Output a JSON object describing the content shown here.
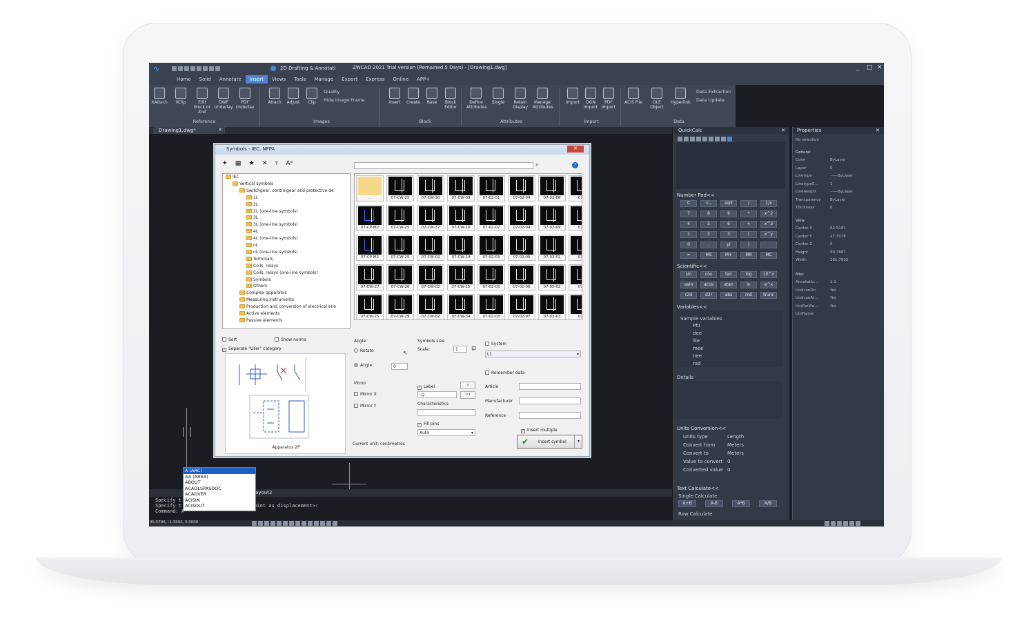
{
  "window": {
    "title": "ZWCAD 2021 Trial version (Remained 5 Days) - [Drawing1.dwg]",
    "workspace": "2D Drafting & Annotati"
  },
  "tabs": [
    "Home",
    "Solid",
    "Annotate",
    "Insert",
    "Views",
    "Tools",
    "Manage",
    "Export",
    "Express",
    "Online",
    "APP+"
  ],
  "ribbon": {
    "reference": [
      "XAttach",
      "XClip",
      "Edit block or Xref",
      "DWF Underlay",
      "PDF Underlay"
    ],
    "images": [
      "Attach",
      "Adjust",
      "Clip"
    ],
    "image_opts": [
      "Quality",
      "Hide Image Frame"
    ],
    "block": [
      "Insert",
      "Create",
      "Base",
      "Block Editor"
    ],
    "attributes": [
      "Define Attributes",
      "Single",
      "Retain Display",
      "Manage Attributes"
    ],
    "import": [
      "Import",
      "DGN Import",
      "PDF Import"
    ],
    "data": [
      "ACIS File",
      "OLE Object",
      "Hyperlink"
    ],
    "data_opts": [
      "Data Extraction",
      "Data Update"
    ],
    "groups": [
      "Reference",
      "Images",
      "Block",
      "Attributes",
      "Import",
      "Data"
    ]
  },
  "doc_tab": "Drawing1.dwg*",
  "dialog": {
    "title": "Symbols - IEC, NFPA",
    "tree": [
      "IEC",
      "Vertical symbols",
      "Switchgear, controlgear and protective de",
      "1L",
      "2L",
      "2L (one-line symbols)",
      "3L",
      "3L (one-line symbols)",
      "4L",
      "4L (one-line symbols)",
      "nL",
      "nL (one-line symbols)",
      "Terminals",
      "Coils, relays",
      "Coils, relays (one-line symbols)",
      "Symbols",
      "Others",
      "Complex apparatus",
      "Measuring instruments",
      "Production and conversion of electrical ene",
      "Active elements",
      "Passive elements"
    ],
    "symbols": [
      "..",
      "07-CW-25",
      "07-CW-30",
      "07-CW-03",
      "07-02-01",
      "07-02-04",
      "07-02-08",
      "07-0",
      "07-CP-M2",
      "07-CW-25",
      "07-CW-37",
      "07-CW-10",
      "07-02-02",
      "07-02-04",
      "07-02-09",
      "07-0",
      "07-CP-M2",
      "07-CW-25",
      "07-CW-02",
      "07-CW-14",
      "07-02-03",
      "07-02-05",
      "07-03-01",
      "07-0",
      "07-CW-27",
      "07-CW-26",
      "07-CW-02",
      "07-CW-15",
      "07-02-03",
      "07-02-06",
      "07-03-02",
      "07-0",
      "07-CW-25",
      "07-CW-29",
      "07-CW-02",
      "07-CW-34",
      "07-02-03",
      "07-02-07",
      "07-03-03",
      "07-0"
    ],
    "sort": "Sort",
    "show_norms": "Show norms",
    "separate_user": "Separate \"User\" category",
    "preview_caption": "Apparatus 2P",
    "angle": "Angle",
    "rotate": "Rotate",
    "angle_label": "Angle:",
    "angle_value": "0",
    "mirror": "Mirror",
    "mirror_x": "Mirror X",
    "mirror_y": "Mirror Y",
    "symbols_size": "Symbols size",
    "scale_label": "Scale:",
    "scale_value": "1",
    "label": "Label",
    "label_value": "-Q",
    "characteristics": "Characteristics",
    "fill_pins": "Fill pins",
    "fill_value": "Auto",
    "system": "System",
    "system_value": "L1",
    "remember": "Remember data",
    "article": "Article",
    "manufacturer": "Manufacturer",
    "reference": "Reference",
    "insert_multiple": "Insert multiple",
    "insert_symbol": "Insert symbol",
    "current_unit": "Current unit: centimetres"
  },
  "quickcalc": {
    "title": "QuickCalc",
    "numpad_title": "Number Pad<<",
    "numpad": [
      "C",
      "<--",
      "sqrt",
      "/",
      "1/x",
      "7",
      "8",
      "9",
      "*",
      "x^2",
      "4",
      "5",
      "6",
      "+",
      "x^3",
      "1",
      "2",
      "3",
      "(",
      "x^y",
      "0",
      ".",
      "pi",
      ")",
      "",
      "=",
      "MS",
      "M+",
      "MR",
      "MC"
    ],
    "sci_title": "Scientific<<",
    "sci": [
      "sin",
      "cos",
      "tan",
      "log",
      "10^x",
      "asin",
      "acos",
      "atan",
      "ln",
      "e^x",
      "r2d",
      "d2r",
      "abs",
      "rnd",
      "trunc"
    ],
    "vars_title": "Variables<<",
    "vars_group": "Sample variables",
    "vars": [
      "Phi",
      "dee",
      "ille",
      "mee",
      "nee",
      "rad"
    ],
    "details": "Details",
    "units_title": "Units Conversion<<",
    "units": [
      [
        "Units type",
        "Length"
      ],
      [
        "Convert from",
        "Meters"
      ],
      [
        "Convert to",
        "Meters"
      ],
      [
        "Value to convert",
        "0"
      ],
      [
        "Converted value",
        "0"
      ]
    ],
    "text_calc": "Text Calculate<<",
    "single_calc": "Single Calculate",
    "text_ops": [
      "A+B",
      "A-B",
      "A*B",
      "A/B"
    ],
    "row_calc": "Row Calculate"
  },
  "properties": {
    "title": "Properties",
    "selection": "No selection",
    "general": "General",
    "general_rows": [
      [
        "Color",
        "ByLayer"
      ],
      [
        "Layer",
        "0"
      ],
      [
        "Linetype",
        "——ByLayer"
      ],
      [
        "LinetypeS...",
        "1"
      ],
      [
        "Lineweight",
        "——ByLayer"
      ],
      [
        "Transparency",
        "ByLayer"
      ],
      [
        "Thickness",
        "0"
      ]
    ],
    "view": "View",
    "view_rows": [
      [
        "Center X",
        "62.5181"
      ],
      [
        "Center Y",
        "47.3178"
      ],
      [
        "Center Z",
        "0"
      ],
      [
        "Height",
        "99.7867"
      ],
      [
        "Width",
        "181.7932"
      ]
    ],
    "misc": "Misc",
    "misc_rows": [
      [
        "Annotatio...",
        "1:1"
      ],
      [
        "UcsIconOn",
        "Yes"
      ],
      [
        "UcsIconAt...",
        "Yes"
      ],
      [
        "UcsPerVie...",
        "Yes"
      ],
      [
        "UcsName",
        ""
      ]
    ]
  },
  "autocomplete": [
    "A (ARC)",
    "AA (AREA)",
    "ABOUT",
    "ACADLSPASDOC",
    "ACADVER",
    "ACISIN",
    "ACISOUT"
  ],
  "command": {
    "tab": "ayout2",
    "lines": [
      "Specify t       lacement] <Displacement>:",
      "Specify t       nd point or <use first point as displacement>:",
      "Command: A"
    ]
  },
  "status": {
    "coords": "45.5706, -1.3202, 0.0000"
  }
}
